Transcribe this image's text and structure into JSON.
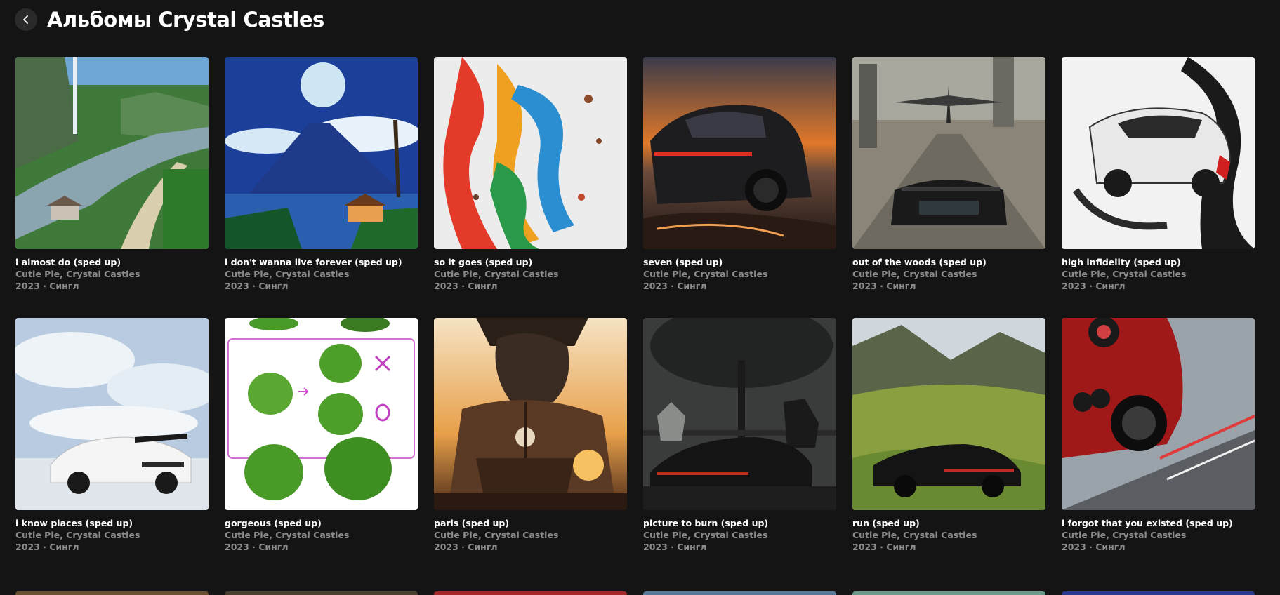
{
  "header": {
    "back_icon": "chevron-left-icon",
    "title": "Альбомы Crystal Castles"
  },
  "albums": [
    {
      "title": "i almost do (sped up)",
      "artists": "Cutie Pie, Crystal Castles",
      "meta": "2023 · Сингл",
      "cover": "tropical-river-landscape"
    },
    {
      "title": "i don't wanna live forever (sped up)",
      "artists": "Cutie Pie, Crystal Castles",
      "meta": "2023 · Сингл",
      "cover": "volcano-moon-night"
    },
    {
      "title": "so it goes (sped up)",
      "artists": "Cutie Pie, Crystal Castles",
      "meta": "2023 · Сингл",
      "cover": "paint-splash"
    },
    {
      "title": "seven (sped up)",
      "artists": "Cutie Pie, Crystal Castles",
      "meta": "2023 · Сингл",
      "cover": "black-sports-car-sunset"
    },
    {
      "title": "out of the woods (sped up)",
      "artists": "Cutie Pie, Crystal Castles",
      "meta": "2023 · Сингл",
      "cover": "jet-over-highway"
    },
    {
      "title": "high infidelity (sped up)",
      "artists": "Cutie Pie, Crystal Castles",
      "meta": "2023 · Сингл",
      "cover": "white-car-ink-splash"
    },
    {
      "title": "i know places (sped up)",
      "artists": "Cutie Pie, Crystal Castles",
      "meta": "2023 · Сингл",
      "cover": "white-car-clouds"
    },
    {
      "title": "gorgeous (sped up)",
      "artists": "Cutie Pie, Crystal Castles",
      "meta": "2023 · Сингл",
      "cover": "green-bushes-sketch"
    },
    {
      "title": "paris (sped up)",
      "artists": "Cutie Pie, Crystal Castles",
      "meta": "2023 · Сингл",
      "cover": "anime-ship-sunset"
    },
    {
      "title": "picture to burn (sped up)",
      "artists": "Cutie Pie, Crystal Castles",
      "meta": "2023 · Сингл",
      "cover": "dark-car-horses"
    },
    {
      "title": "run (sped up)",
      "artists": "Cutie Pie, Crystal Castles",
      "meta": "2023 · Сингл",
      "cover": "black-car-valley"
    },
    {
      "title": "i forgot that you existed (sped up)",
      "artists": "Cutie Pie, Crystal Castles",
      "meta": "2023 · Сингл",
      "cover": "red-car-motion"
    }
  ],
  "colors": {
    "background": "#141414",
    "text_primary": "#ffffff",
    "text_secondary": "#8c8c8c",
    "back_button_bg": "#2a2a2a"
  }
}
